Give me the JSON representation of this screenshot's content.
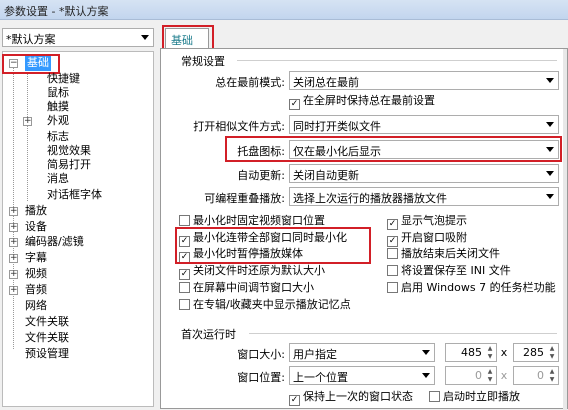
{
  "window": {
    "title": "参数设置 - *默认方案"
  },
  "sidebar": {
    "scheme": "*默认方案",
    "tree": {
      "basic": "基础",
      "basic_children": [
        "快捷键",
        "鼠标",
        "触摸",
        "外观",
        "标志",
        "视觉效果",
        "简易打开",
        "消息",
        "对话框字体"
      ],
      "sections": [
        "播放",
        "设备",
        "编码器/滤镜",
        "字幕",
        "视频",
        "音频",
        "网络",
        "文件关联",
        "文件关联",
        "预设管理"
      ]
    }
  },
  "main": {
    "tab": "基础",
    "general": {
      "title": "常规设置",
      "always_on_top": {
        "label": "总在最前模式:",
        "value": "关闭总在最前"
      },
      "fullscreen_keep": "在全屏时保持总在最前设置",
      "open_similar": {
        "label": "打开相似文件方式:",
        "value": "同时打开类似文件"
      },
      "tray_icon": {
        "label": "托盘图标:",
        "value": "仅在最小化后显示"
      },
      "auto_update": {
        "label": "自动更新:",
        "value": "关闭自动更新"
      },
      "reopen_player": {
        "label": "可编程重叠播放:",
        "value": "选择上次运行的播放器播放文件"
      }
    },
    "checkboxes_left": [
      {
        "label": "最小化时固定视频窗口位置",
        "checked": false
      },
      {
        "label": "最小化连带全部窗口同时最小化",
        "checked": true
      },
      {
        "label": "最小化时暂停播放媒体",
        "checked": true
      },
      {
        "label": "关闭文件时还原为默认大小",
        "checked": true
      },
      {
        "label": "在屏幕中间调节窗口大小",
        "checked": false
      },
      {
        "label": "在专辑/收藏夹中显示播放记忆点",
        "checked": false
      }
    ],
    "checkboxes_right": [
      {
        "label": "显示气泡提示",
        "checked": true
      },
      {
        "label": "开启窗口吸附",
        "checked": true
      },
      {
        "label": "播放结束后关闭文件",
        "checked": false
      },
      {
        "label": "将设置保存至 INI 文件",
        "checked": false
      },
      {
        "label": "启用 Windows 7 的任务栏功能",
        "checked": false
      }
    ],
    "first_run": {
      "title": "首次运行时",
      "window_size": {
        "label": "窗口大小:",
        "value": "用户指定",
        "w": "485",
        "sep": "x",
        "h": "285"
      },
      "window_pos": {
        "label": "窗口位置:",
        "value": "上一个位置",
        "x": "0",
        "sep": "x",
        "y": "0"
      },
      "keep_state": "保持上一次的窗口状态",
      "start_play": "启动时立即播放"
    }
  }
}
